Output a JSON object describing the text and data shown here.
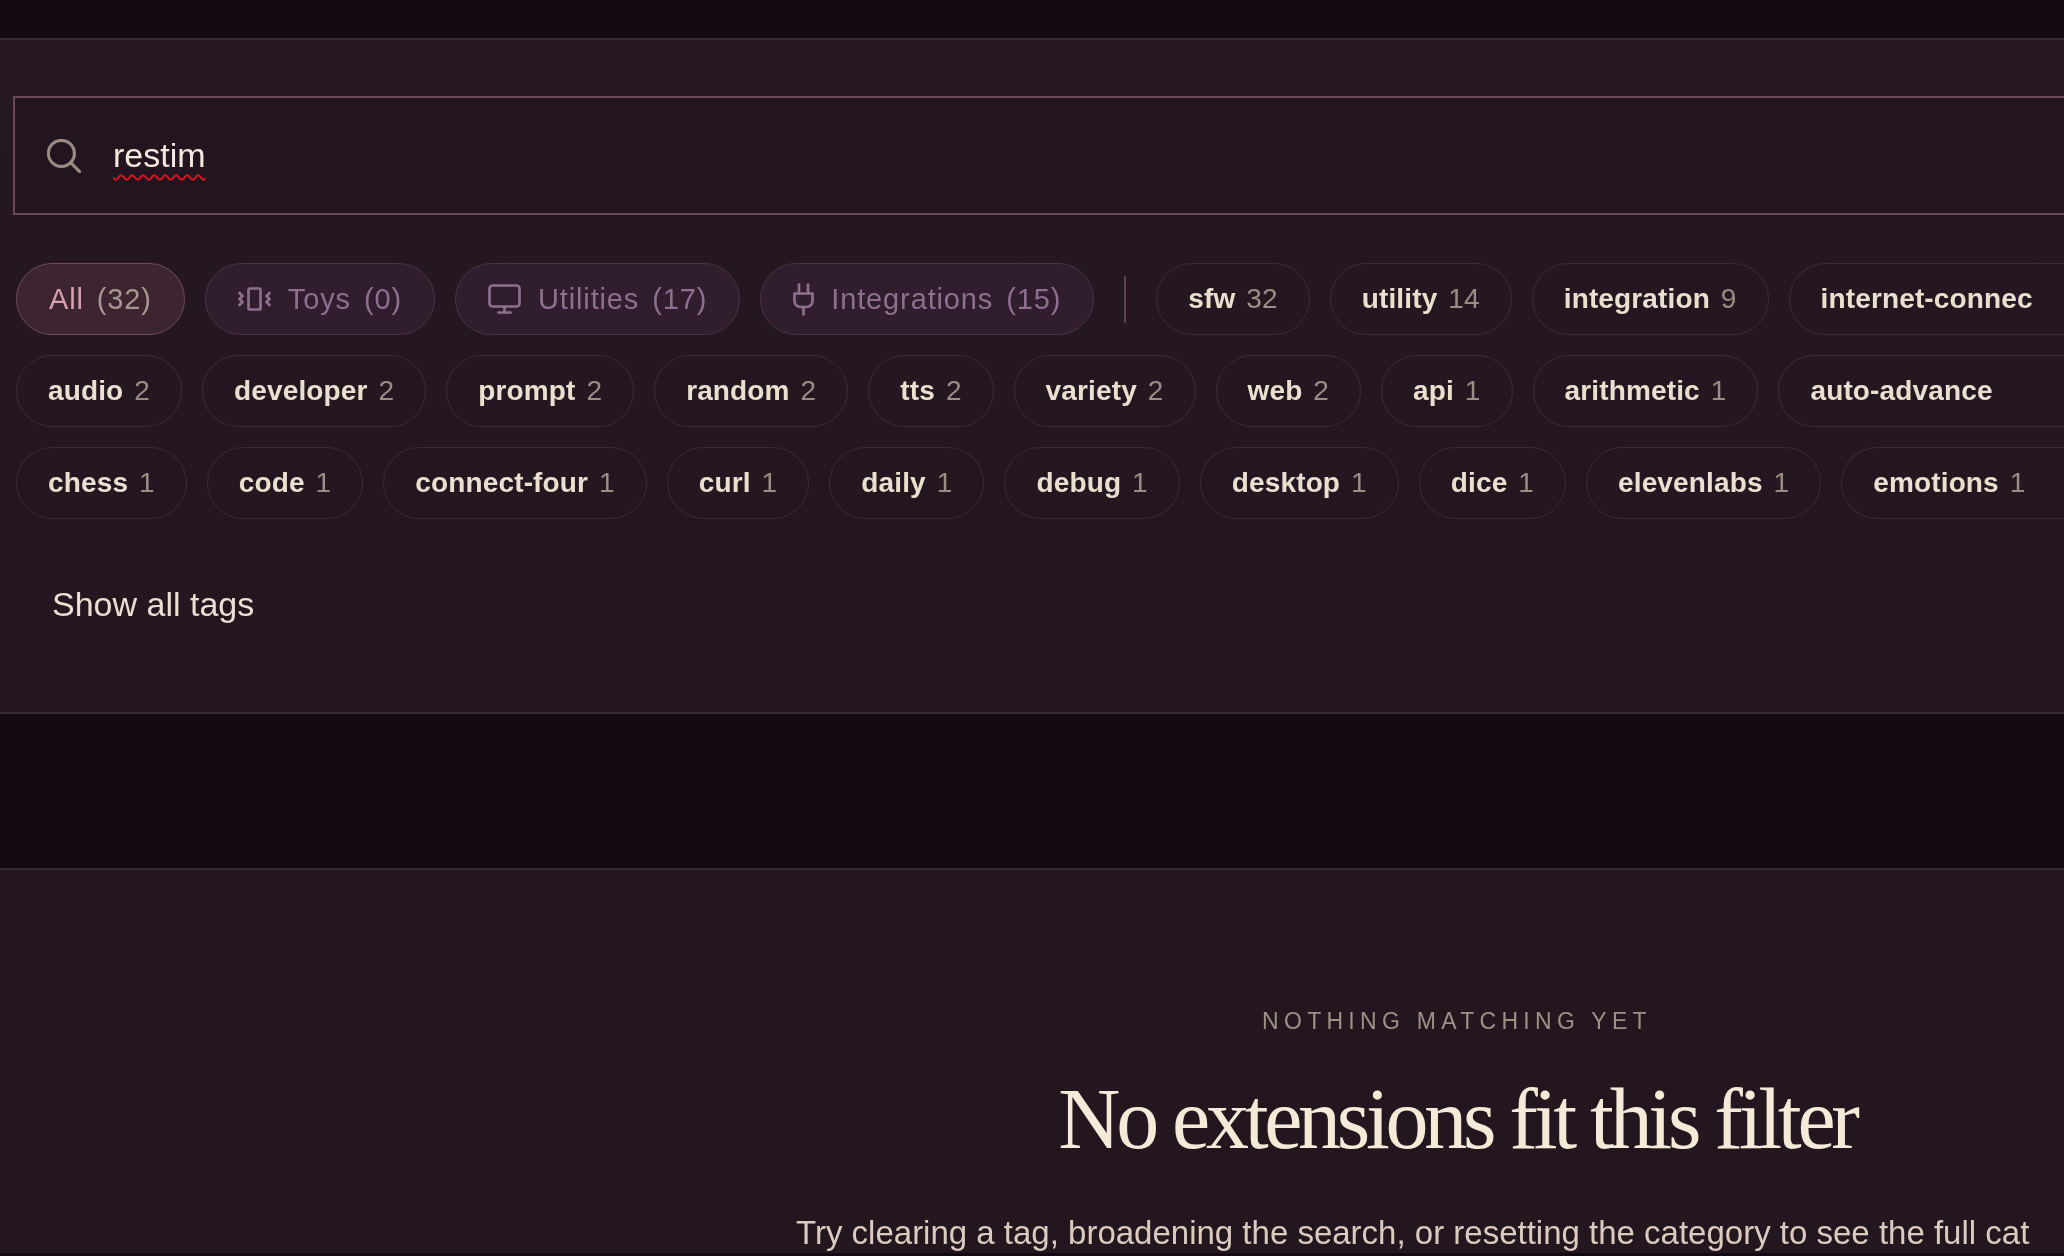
{
  "search": {
    "value": "restim",
    "misspelled": true
  },
  "categories": [
    {
      "kind": "all",
      "label": "All",
      "count": "(32)",
      "selected": true
    },
    {
      "kind": "toys",
      "label": "Toys",
      "count": "(0)",
      "selected": false
    },
    {
      "kind": "utilities",
      "label": "Utilities",
      "count": "(17)",
      "selected": false
    },
    {
      "kind": "integrations",
      "label": "Integrations",
      "count": "(15)",
      "selected": false
    }
  ],
  "tag_rows": [
    [
      {
        "name": "sfw",
        "count": "32",
        "selected": false
      },
      {
        "name": "utility",
        "count": "14",
        "selected": false
      },
      {
        "name": "integration",
        "count": "9",
        "selected": false
      },
      {
        "name": "internet-connec",
        "selected": false
      }
    ],
    [
      {
        "name": "audio",
        "count": "2",
        "selected": false
      },
      {
        "name": "developer",
        "count": "2",
        "selected": false
      },
      {
        "name": "prompt",
        "count": "2",
        "selected": false
      },
      {
        "name": "random",
        "count": "2",
        "selected": false
      },
      {
        "name": "tts",
        "count": "2",
        "selected": false
      },
      {
        "name": "variety",
        "count": "2",
        "selected": false
      },
      {
        "name": "web",
        "count": "2",
        "selected": false
      },
      {
        "name": "api",
        "count": "1",
        "selected": false
      },
      {
        "name": "arithmetic",
        "count": "1",
        "selected": false
      },
      {
        "name": "auto-advance",
        "selected": false
      }
    ],
    [
      {
        "name": "chess",
        "count": "1",
        "selected": false
      },
      {
        "name": "code",
        "count": "1",
        "selected": false
      },
      {
        "name": "connect-four",
        "count": "1",
        "selected": false
      },
      {
        "name": "curl",
        "count": "1",
        "selected": false
      },
      {
        "name": "daily",
        "count": "1",
        "selected": false
      },
      {
        "name": "debug",
        "count": "1",
        "selected": false
      },
      {
        "name": "desktop",
        "count": "1",
        "selected": false
      },
      {
        "name": "dice",
        "count": "1",
        "selected": false
      },
      {
        "name": "elevenlabs",
        "count": "1",
        "selected": false
      },
      {
        "name": "emotions",
        "count": "1",
        "selected": false
      }
    ]
  ],
  "show_all_tags": "Show all tags",
  "empty_state": {
    "eyebrow": "NOTHING MATCHING YET",
    "title": "No extensions fit this filter",
    "message": "Try clearing a tag, broadening the search, or resetting the category to see the full cat"
  }
}
